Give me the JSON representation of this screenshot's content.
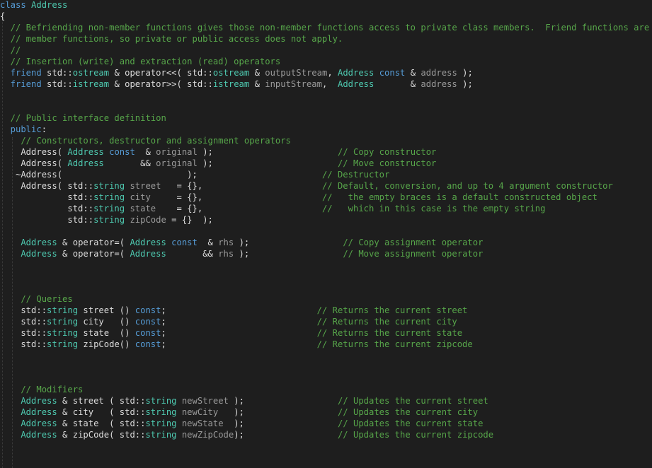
{
  "editor": {
    "colors": {
      "background": "#1e1e1e",
      "comment": "#57a64a",
      "keyword": "#569cd6",
      "type": "#4ec9b0",
      "text": "#dcdcdc",
      "parameter": "#9a9a9a"
    },
    "lines": [
      [
        [
          "keyword",
          "class"
        ],
        [
          "plain",
          " "
        ],
        [
          "type",
          "Address"
        ]
      ],
      [
        [
          "plain",
          "{"
        ]
      ],
      [
        [
          "comment",
          "  // Befriending non-member functions gives those non-member functions access to private class members.  Friend functions are not"
        ]
      ],
      [
        [
          "comment",
          "  // member functions, so private or public access does not apply."
        ]
      ],
      [
        [
          "comment",
          "  //"
        ]
      ],
      [
        [
          "comment",
          "  // Insertion (write) and extraction (read) operators"
        ]
      ],
      [
        [
          "keyword",
          "  friend"
        ],
        [
          "plain",
          " std::"
        ],
        [
          "type",
          "ostream"
        ],
        [
          "plain",
          " & operator<<( std::"
        ],
        [
          "type",
          "ostream"
        ],
        [
          "plain",
          " & "
        ],
        [
          "param",
          "outputStream"
        ],
        [
          "plain",
          ", "
        ],
        [
          "type",
          "Address"
        ],
        [
          "keyword",
          " const"
        ],
        [
          "plain",
          " & "
        ],
        [
          "param",
          "address"
        ],
        [
          "plain",
          " );"
        ]
      ],
      [
        [
          "keyword",
          "  friend"
        ],
        [
          "plain",
          " std::"
        ],
        [
          "type",
          "istream"
        ],
        [
          "plain",
          " & operator>>( std::"
        ],
        [
          "type",
          "istream"
        ],
        [
          "plain",
          " & "
        ],
        [
          "param",
          "inputStream"
        ],
        [
          "plain",
          ",  "
        ],
        [
          "type",
          "Address"
        ],
        [
          "plain",
          "       & "
        ],
        [
          "param",
          "address"
        ],
        [
          "plain",
          " );"
        ]
      ],
      [],
      [],
      [
        [
          "comment",
          "  // Public interface definition"
        ]
      ],
      [
        [
          "keyword",
          "  public"
        ],
        [
          "plain",
          ":"
        ]
      ],
      [
        [
          "comment",
          "    // Constructors, destructor and assignment operators"
        ]
      ],
      [
        [
          "plain",
          "    Address( "
        ],
        [
          "type",
          "Address"
        ],
        [
          "keyword",
          " const"
        ],
        [
          "plain",
          "  & "
        ],
        [
          "param",
          "original"
        ],
        [
          "plain",
          " );                        "
        ],
        [
          "comment",
          "// Copy constructor"
        ]
      ],
      [
        [
          "plain",
          "    Address( "
        ],
        [
          "type",
          "Address"
        ],
        [
          "plain",
          "       && "
        ],
        [
          "param",
          "original"
        ],
        [
          "plain",
          " );                        "
        ],
        [
          "comment",
          "// Move constructor"
        ]
      ],
      [
        [
          "plain",
          "   ~Address(                        );                        "
        ],
        [
          "comment",
          "// Destructor"
        ]
      ],
      [
        [
          "plain",
          "    Address( std::"
        ],
        [
          "type",
          "string"
        ],
        [
          "plain",
          " "
        ],
        [
          "param",
          "street"
        ],
        [
          "plain",
          "   = {},                       "
        ],
        [
          "comment",
          "// Default, conversion, and up to 4 argument constructor"
        ]
      ],
      [
        [
          "plain",
          "             std::"
        ],
        [
          "type",
          "string"
        ],
        [
          "plain",
          " "
        ],
        [
          "param",
          "city"
        ],
        [
          "plain",
          "     = {},                       "
        ],
        [
          "comment",
          "//   the empty braces is a default constructed object"
        ]
      ],
      [
        [
          "plain",
          "             std::"
        ],
        [
          "type",
          "string"
        ],
        [
          "plain",
          " "
        ],
        [
          "param",
          "state"
        ],
        [
          "plain",
          "    = {},                       "
        ],
        [
          "comment",
          "//   which in this case is the empty string"
        ]
      ],
      [
        [
          "plain",
          "             std::"
        ],
        [
          "type",
          "string"
        ],
        [
          "plain",
          " "
        ],
        [
          "param",
          "zipCode"
        ],
        [
          "plain",
          " = {}  );"
        ]
      ],
      [],
      [
        [
          "type",
          "    Address"
        ],
        [
          "plain",
          " & operator=( "
        ],
        [
          "type",
          "Address"
        ],
        [
          "keyword",
          " const"
        ],
        [
          "plain",
          "  & "
        ],
        [
          "param",
          "rhs"
        ],
        [
          "plain",
          " );                  "
        ],
        [
          "comment",
          "// Copy assignment operator"
        ]
      ],
      [
        [
          "type",
          "    Address"
        ],
        [
          "plain",
          " & operator=( "
        ],
        [
          "type",
          "Address"
        ],
        [
          "plain",
          "       && "
        ],
        [
          "param",
          "rhs"
        ],
        [
          "plain",
          " );                  "
        ],
        [
          "comment",
          "// Move assignment operator"
        ]
      ],
      [],
      [],
      [],
      [
        [
          "comment",
          "    // Queries"
        ]
      ],
      [
        [
          "plain",
          "    std::"
        ],
        [
          "type",
          "string"
        ],
        [
          "plain",
          " street () "
        ],
        [
          "keyword",
          "const"
        ],
        [
          "plain",
          ";                             "
        ],
        [
          "comment",
          "// Returns the current street"
        ]
      ],
      [
        [
          "plain",
          "    std::"
        ],
        [
          "type",
          "string"
        ],
        [
          "plain",
          " city   () "
        ],
        [
          "keyword",
          "const"
        ],
        [
          "plain",
          ";                             "
        ],
        [
          "comment",
          "// Returns the current city"
        ]
      ],
      [
        [
          "plain",
          "    std::"
        ],
        [
          "type",
          "string"
        ],
        [
          "plain",
          " state  () "
        ],
        [
          "keyword",
          "const"
        ],
        [
          "plain",
          ";                             "
        ],
        [
          "comment",
          "// Returns the current state"
        ]
      ],
      [
        [
          "plain",
          "    std::"
        ],
        [
          "type",
          "string"
        ],
        [
          "plain",
          " zipCode() "
        ],
        [
          "keyword",
          "const"
        ],
        [
          "plain",
          ";                             "
        ],
        [
          "comment",
          "// Returns the current zipcode"
        ]
      ],
      [],
      [],
      [],
      [
        [
          "comment",
          "    // Modifiers"
        ]
      ],
      [
        [
          "type",
          "    Address"
        ],
        [
          "plain",
          " & street ( std::"
        ],
        [
          "type",
          "string"
        ],
        [
          "plain",
          " "
        ],
        [
          "param",
          "newStreet"
        ],
        [
          "plain",
          " );                  "
        ],
        [
          "comment",
          "// Updates the current street"
        ]
      ],
      [
        [
          "type",
          "    Address"
        ],
        [
          "plain",
          " & city   ( std::"
        ],
        [
          "type",
          "string"
        ],
        [
          "plain",
          " "
        ],
        [
          "param",
          "newCity"
        ],
        [
          "plain",
          "   );                  "
        ],
        [
          "comment",
          "// Updates the current city"
        ]
      ],
      [
        [
          "type",
          "    Address"
        ],
        [
          "plain",
          " & state  ( std::"
        ],
        [
          "type",
          "string"
        ],
        [
          "plain",
          " "
        ],
        [
          "param",
          "newState"
        ],
        [
          "plain",
          "  );                  "
        ],
        [
          "comment",
          "// Updates the current state"
        ]
      ],
      [
        [
          "type",
          "    Address"
        ],
        [
          "plain",
          " & zipCode( std::"
        ],
        [
          "type",
          "string"
        ],
        [
          "plain",
          " "
        ],
        [
          "param",
          "newZipCode"
        ],
        [
          "plain",
          ");                  "
        ],
        [
          "comment",
          "// Updates the current zipcode"
        ]
      ],
      [],
      []
    ]
  }
}
